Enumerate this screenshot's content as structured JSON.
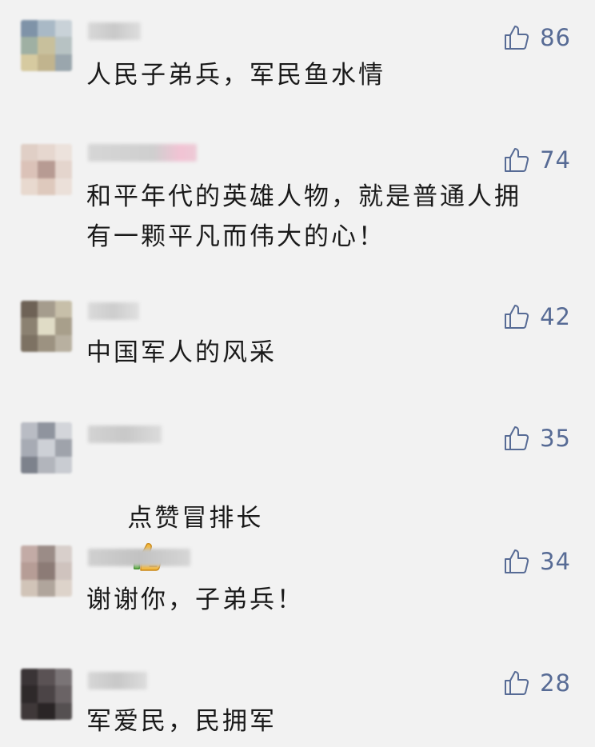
{
  "comments": [
    {
      "text": "人民子弟兵，军民鱼水情",
      "likes": "86"
    },
    {
      "text": "和平年代的英雄人物，就是普通人拥\n有一颗平凡而伟大的心！",
      "likes": "74"
    },
    {
      "text": "中国军人的风采",
      "likes": "42"
    },
    {
      "text": "点赞冒排长",
      "likes": "35",
      "emoji": "thumbs-up-emoji"
    },
    {
      "text": "谢谢你，子弟兵！",
      "likes": "34"
    },
    {
      "text": "军爱民，民拥军",
      "likes": "28"
    }
  ],
  "colors": {
    "background": "#f2f2f2",
    "like_blue": "#576b95",
    "text": "#1a1a1a"
  },
  "icons": {
    "like": "thumbs-up-outline-icon",
    "emoji": "thumbs-up-emoji"
  }
}
